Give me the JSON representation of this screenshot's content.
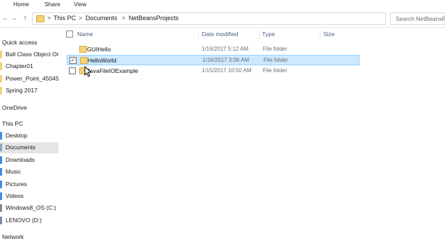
{
  "ribbon": {
    "tabs": [
      "Home",
      "Share",
      "View"
    ]
  },
  "address_bar": {
    "breadcrumbs": [
      "This PC",
      "Documents",
      "NetBeansProjects"
    ],
    "separator": ">",
    "dropdown": "˅",
    "refresh_symbol": "↻"
  },
  "nav_buttons": {
    "back": "←",
    "forward": "→",
    "up": "↑"
  },
  "search": {
    "placeholder": "Search NetBeansProjects"
  },
  "navpane": {
    "quick_access_label": "Quick access",
    "quick_access_items": [
      "Ball Class Object Or",
      "Chapter01",
      "Power_Point_45045",
      "Spring 2017"
    ],
    "onedrive_label": "OneDrive",
    "this_pc_label": "This PC",
    "this_pc_items": [
      "Desktop",
      "Documents",
      "Downloads",
      "Music",
      "Pictures",
      "Videos",
      "Windows8_OS (C:)",
      "LENOVO (D:)"
    ],
    "network_label": "Network",
    "selected": "Documents"
  },
  "columns": {
    "name": "Name",
    "date_modified": "Date modified",
    "type": "Type",
    "size": "Size"
  },
  "files": [
    {
      "name": "GUIHello",
      "date": "1/16/2017 5:12 AM",
      "type": "File folder",
      "selected": false
    },
    {
      "name": "HelloWorld",
      "date": "1/16/2017 3:06 AM",
      "type": "File folder",
      "selected": true
    },
    {
      "name": "JavaFileIOExample",
      "date": "1/15/2017 10:50 AM",
      "type": "File folder",
      "selected": false
    }
  ],
  "check_mark": "✓",
  "colors": {
    "selection_bg": "#cce8ff",
    "selection_border": "#99d1ff",
    "folder": "#f3d27a",
    "nav_selected": "#e5e5e5"
  }
}
